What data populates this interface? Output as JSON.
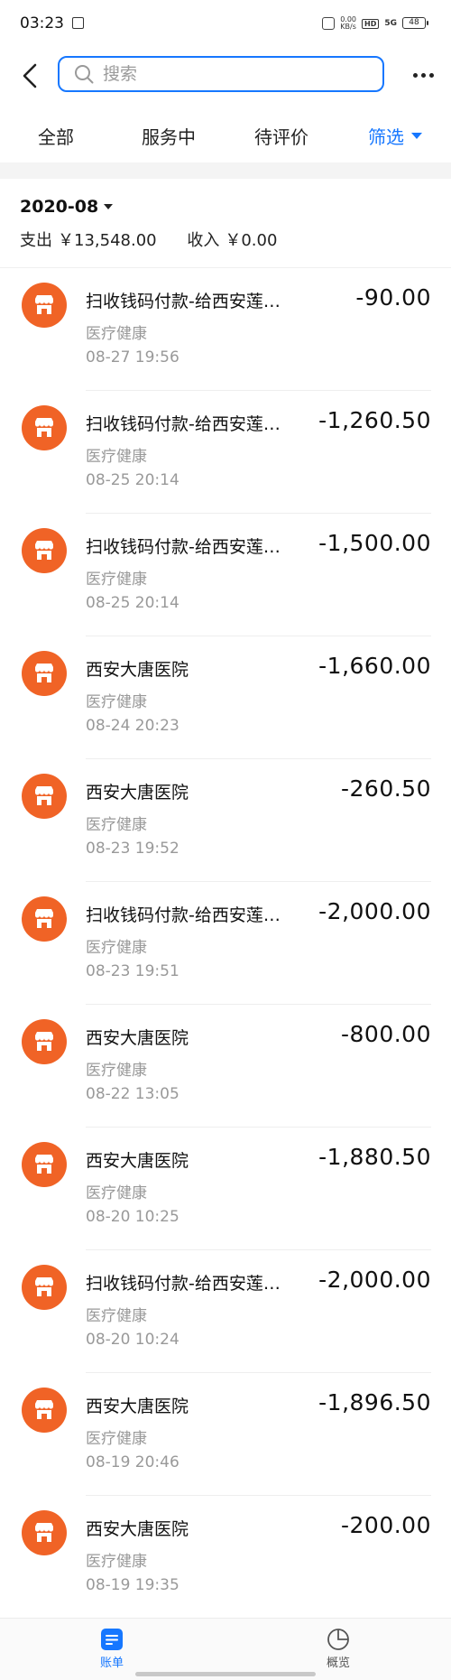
{
  "status_bar": {
    "time": "03:23",
    "speed_value": "0.00",
    "speed_unit": "KB/s",
    "hd": "HD",
    "signal": "5G",
    "battery": "48"
  },
  "search": {
    "placeholder": "搜索"
  },
  "tabs": [
    {
      "label": "全部"
    },
    {
      "label": "服务中"
    },
    {
      "label": "待评价"
    },
    {
      "label": "筛选"
    }
  ],
  "month": {
    "label": "2020-08",
    "expense_label": "支出",
    "expense_value": "￥13,548.00",
    "income_label": "收入",
    "income_value": "￥0.00"
  },
  "transactions": [
    {
      "title": "扫收钱码付款-给西安莲…",
      "category": "医疗健康",
      "time": "08-27  19:56",
      "amount": "-90.00"
    },
    {
      "title": "扫收钱码付款-给西安莲…",
      "category": "医疗健康",
      "time": "08-25  20:14",
      "amount": "-1,260.50"
    },
    {
      "title": "扫收钱码付款-给西安莲…",
      "category": "医疗健康",
      "time": "08-25  20:14",
      "amount": "-1,500.00"
    },
    {
      "title": "西安大唐医院",
      "category": "医疗健康",
      "time": "08-24  20:23",
      "amount": "-1,660.00"
    },
    {
      "title": "西安大唐医院",
      "category": "医疗健康",
      "time": "08-23  19:52",
      "amount": "-260.50"
    },
    {
      "title": "扫收钱码付款-给西安莲…",
      "category": "医疗健康",
      "time": "08-23  19:51",
      "amount": "-2,000.00"
    },
    {
      "title": "西安大唐医院",
      "category": "医疗健康",
      "time": "08-22  13:05",
      "amount": "-800.00"
    },
    {
      "title": "西安大唐医院",
      "category": "医疗健康",
      "time": "08-20  10:25",
      "amount": "-1,880.50"
    },
    {
      "title": "扫收钱码付款-给西安莲…",
      "category": "医疗健康",
      "time": "08-20  10:24",
      "amount": "-2,000.00"
    },
    {
      "title": "西安大唐医院",
      "category": "医疗健康",
      "time": "08-19  20:46",
      "amount": "-1,896.50"
    },
    {
      "title": "西安大唐医院",
      "category": "医疗健康",
      "time": "08-19  19:35",
      "amount": "-200.00"
    }
  ],
  "bottom_nav": {
    "bill": "账单",
    "overview": "概览"
  },
  "colors": {
    "accent": "#1677ff",
    "merchant_icon": "#f06326"
  }
}
